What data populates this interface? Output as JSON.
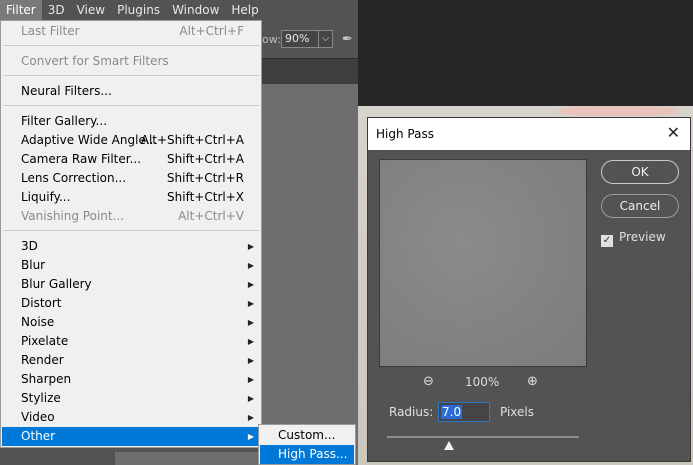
{
  "menubar": {
    "items": [
      {
        "label": "Filter",
        "active": true
      },
      {
        "label": "3D"
      },
      {
        "label": "View"
      },
      {
        "label": "Plugins"
      },
      {
        "label": "Window"
      },
      {
        "label": "Help"
      }
    ]
  },
  "options_bar": {
    "flow_label": "ow:",
    "flow_value": "90%"
  },
  "filter_menu": {
    "last_filter": {
      "label": "Last Filter",
      "shortcut": "Alt+Ctrl+F"
    },
    "convert": {
      "label": "Convert for Smart Filters"
    },
    "neural": {
      "label": "Neural Filters..."
    },
    "gallery": {
      "label": "Filter Gallery..."
    },
    "adaptive": {
      "label": "Adaptive Wide Angle...",
      "shortcut": "Alt+Shift+Ctrl+A"
    },
    "camera_raw": {
      "label": "Camera Raw Filter...",
      "shortcut": "Shift+Ctrl+A"
    },
    "lens": {
      "label": "Lens Correction...",
      "shortcut": "Shift+Ctrl+R"
    },
    "liquify": {
      "label": "Liquify...",
      "shortcut": "Shift+Ctrl+X"
    },
    "vanishing": {
      "label": "Vanishing Point...",
      "shortcut": "Alt+Ctrl+V"
    },
    "submenus": [
      "3D",
      "Blur",
      "Blur Gallery",
      "Distort",
      "Noise",
      "Pixelate",
      "Render",
      "Sharpen",
      "Stylize",
      "Video",
      "Other"
    ]
  },
  "other_submenu": {
    "custom": "Custom...",
    "high_pass": "High Pass..."
  },
  "dialog": {
    "title": "High Pass",
    "zoom": "100%",
    "ok_label": "OK",
    "cancel_label": "Cancel",
    "preview_label": "Preview",
    "preview_checked": true,
    "radius_label": "Radius:",
    "radius_value": "7.0",
    "units": "Pixels",
    "slider_fraction": 0.3
  }
}
